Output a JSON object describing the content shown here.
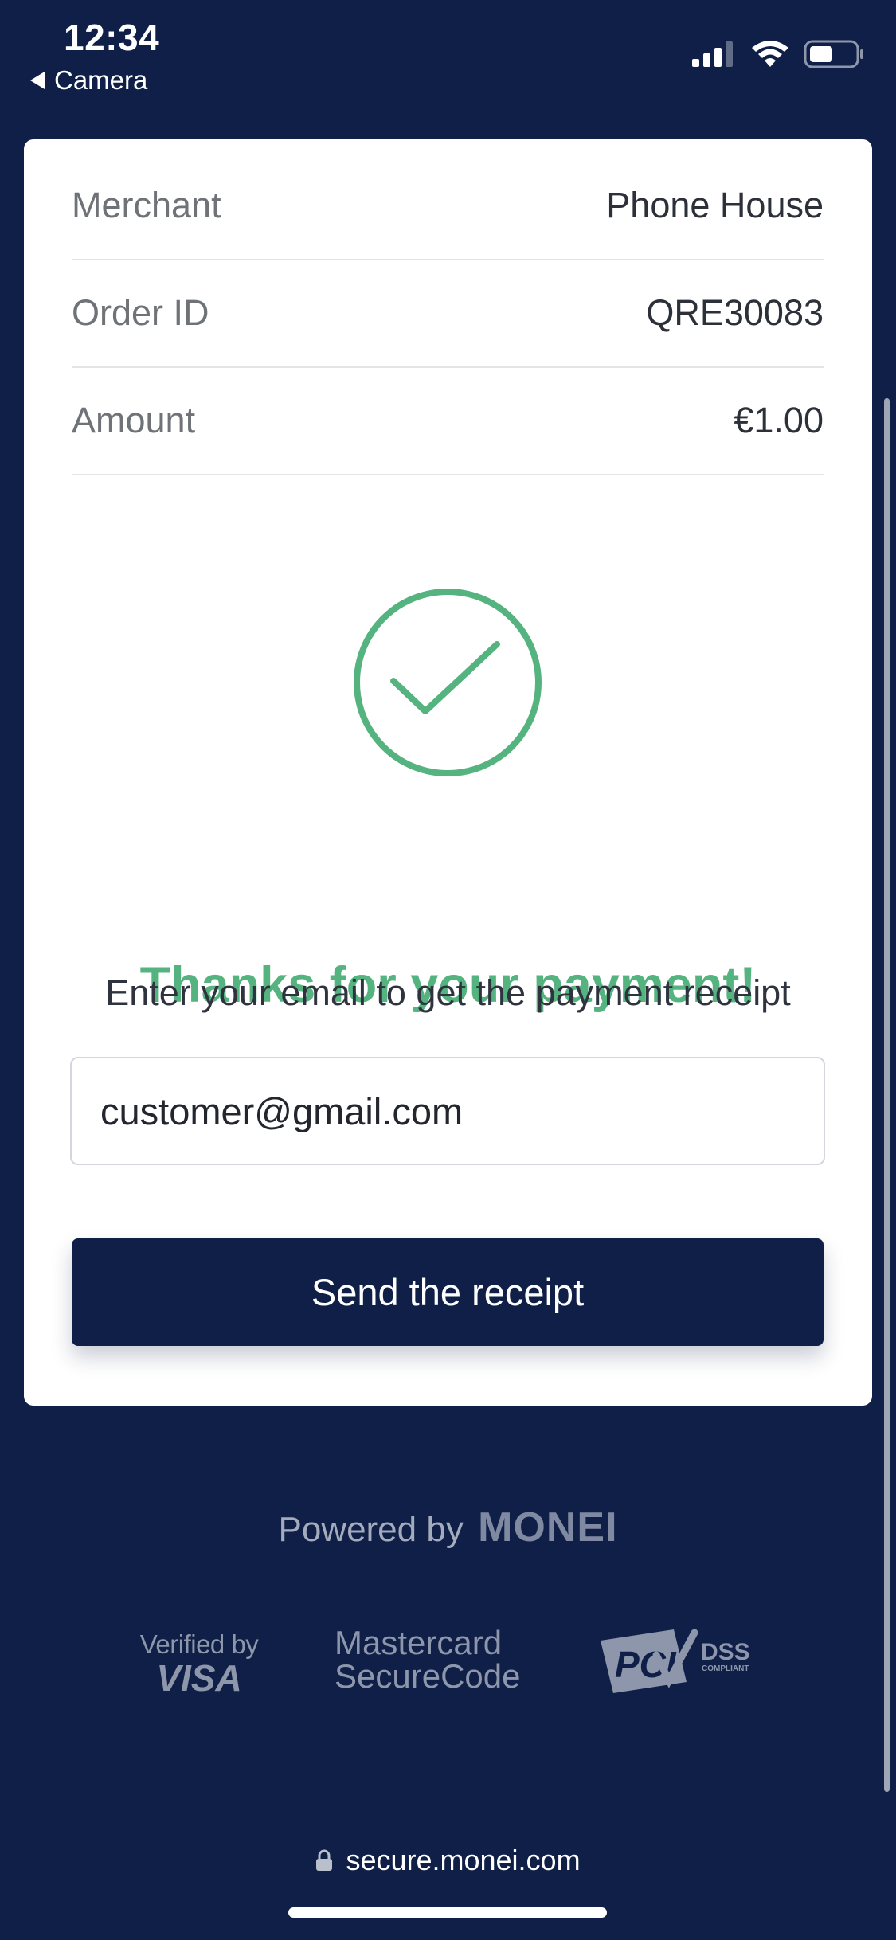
{
  "status_bar": {
    "time": "12:34",
    "back_label": "Camera"
  },
  "order_summary": {
    "rows": [
      {
        "label": "Merchant",
        "value": "Phone House"
      },
      {
        "label": "Order ID",
        "value": "QRE30083"
      },
      {
        "label": "Amount",
        "value": "€1.00"
      }
    ]
  },
  "confirmation": {
    "title": "Thanks for your payment!",
    "icon": "checkmark-circle-icon"
  },
  "receipt": {
    "prompt": "Enter your email to get the payment receipt",
    "email_value": "customer@gmail.com",
    "send_label": "Send the receipt"
  },
  "footer": {
    "powered_by": "Powered by",
    "brand": "MONEI",
    "visa_small": "Verified by",
    "visa_big": "VISA",
    "mc_line1": "Mastercard",
    "mc_line2": "SecureCode",
    "pci_main": "PCI",
    "pci_dss": "DSS",
    "pci_compliant": "COMPLIANT"
  },
  "browser": {
    "url": "secure.monei.com"
  },
  "colors": {
    "background": "#0f1f47",
    "success": "#55b380",
    "card": "#ffffff"
  }
}
